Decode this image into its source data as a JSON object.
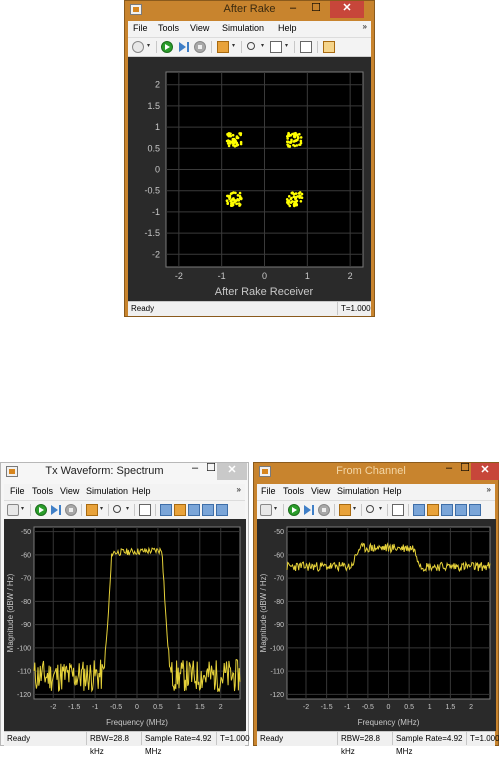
{
  "menu_items": [
    "File",
    "Tools",
    "View",
    "Simulation",
    "Help"
  ],
  "windows": {
    "after_rake": {
      "title": "After Rake",
      "status": "Ready",
      "time": "T=1.000",
      "plot": {
        "type": "scatter",
        "xlabel": "After Rake Receiver",
        "xticks": [
          "-2",
          "-1",
          "0",
          "1",
          "2"
        ],
        "yticks": [
          "2",
          "1.5",
          "1",
          "0.5",
          "0",
          "-0.5",
          "-1",
          "-1.5",
          "-2"
        ],
        "xlim": [
          -2.3,
          2.3
        ],
        "ylim": [
          -2.3,
          2.3
        ],
        "clusters": [
          {
            "x": -0.71,
            "y": 0.7
          },
          {
            "x": 0.71,
            "y": 0.7
          },
          {
            "x": -0.71,
            "y": -0.7
          },
          {
            "x": 0.71,
            "y": -0.7
          }
        ],
        "color": "#ffff00",
        "grid": true
      }
    },
    "tx_spectrum": {
      "title": "Tx Waveform: Spectrum",
      "status": "Ready",
      "rbw": "RBW=28.8 kHz",
      "sample_rate": "Sample Rate=4.92 MHz",
      "time": "T=1.000"
    },
    "from_channel": {
      "title": "From Channel",
      "status": "Ready",
      "rbw": "RBW=28.8 kHz",
      "sample_rate": "Sample Rate=4.92 MHz",
      "time": "T=1.000"
    }
  },
  "chart_data": [
    {
      "type": "scatter",
      "title": "After Rake",
      "xlabel": "After Rake Receiver",
      "ylabel": "",
      "xlim": [
        -2.3,
        2.3
      ],
      "ylim": [
        -2.3,
        2.3
      ],
      "series": [
        {
          "points": [
            [
              -0.71,
              0.7
            ],
            [
              0.71,
              0.7
            ],
            [
              -0.71,
              -0.7
            ],
            [
              0.71,
              -0.7
            ]
          ]
        }
      ]
    },
    {
      "type": "line",
      "title": "Tx Waveform: Spectrum",
      "xlabel": "Frequency (MHz)",
      "ylabel": "Magnitude (dBW / Hz)",
      "xticks": [
        "-2",
        "-1.5",
        "-1",
        "-0.5",
        "0",
        "0.5",
        "1",
        "1.5",
        "2"
      ],
      "yticks": [
        "-50",
        "-60",
        "-70",
        "-80",
        "-90",
        "-100",
        "-110",
        "-120"
      ],
      "xlim": [
        -2.46,
        2.46
      ],
      "ylim": [
        -122,
        -48
      ],
      "x": [
        -2.46,
        -0.8,
        -0.7,
        -0.6,
        0.6,
        0.7,
        0.8,
        2.46
      ],
      "series": [
        {
          "values": [
            -112,
            -112,
            -90,
            -59,
            -58,
            -90,
            -112,
            -112
          ]
        }
      ],
      "color": "#e6d23a",
      "grid": true
    },
    {
      "type": "line",
      "title": "From Channel",
      "xlabel": "Frequency (MHz)",
      "ylabel": "Magnitude (dBW / Hz)",
      "xticks": [
        "-2",
        "-1.5",
        "-1",
        "-0.5",
        "0",
        "0.5",
        "1",
        "1.5",
        "2"
      ],
      "yticks": [
        "-50",
        "-60",
        "-70",
        "-80",
        "-90",
        "-100",
        "-110",
        "-120"
      ],
      "xlim": [
        -2.46,
        2.46
      ],
      "ylim": [
        -122,
        -48
      ],
      "x": [
        -2.46,
        -0.9,
        -0.7,
        0.6,
        0.8,
        2.46
      ],
      "series": [
        {
          "values": [
            -65,
            -65,
            -57,
            -57,
            -65,
            -65
          ]
        }
      ],
      "color": "#e6d23a",
      "grid": true
    }
  ]
}
